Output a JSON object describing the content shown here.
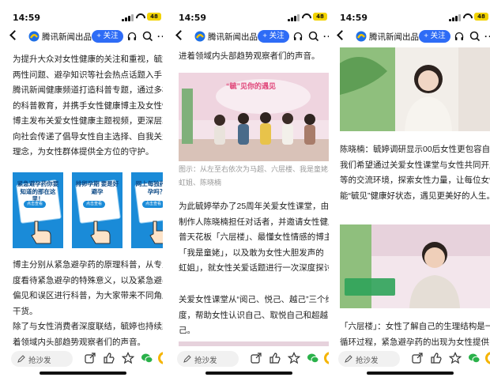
{
  "status": {
    "time": "14:59",
    "battery": "48"
  },
  "header": {
    "source": "腾讯新闻出品",
    "follow_label": "+ 关注"
  },
  "bottom": {
    "comment_placeholder": "抢沙发"
  },
  "colors": {
    "accent": "#2e6cf6",
    "card_blue": "#1a8bd8",
    "stage_pink": "#e0477a"
  },
  "icons": [
    "back-icon",
    "tencent-logo-icon",
    "headphones-icon",
    "search-icon",
    "more-icon",
    "pen-icon",
    "share-icon",
    "like-icon",
    "star-icon",
    "wechat-icon",
    "moments-icon"
  ],
  "screen1": {
    "para1": "为提升大众对女性健康的关注和重视，毓婷从两性问题、避孕知识等社会热点话题入手，在腾讯新闻健康频道打造科普专题，通过多样化的科普教育，并携手女性健康博主及女性情感博主发布关爱女性健康主题视频，更深层次地向社会传递了倡导女性自主选择、自我关爱的理念，为女性群体提供全方位的守护。",
    "cards": [
      {
        "title": "紧急避孕药你要知道的那在这里！",
        "button": "点击查看"
      },
      {
        "title": "排卵孕期 要是好避孕",
        "button": "点击查看"
      },
      {
        "title": "网上每独药能避孕吗？",
        "button": "点击查看"
      }
    ],
    "para2": "博主分别从紧急避孕药的原理科普，从专业角度看待紧急避孕的特殊意义，以及紧急避孕的偏见和误区进行科普，为大家带来不同角度的干货。",
    "para3": "除了与女性消费者深度联结，毓婷也持续跟进着领域内头部趋势观察者们的声音。"
  },
  "screen2": {
    "para_top": "进着领域内头部趋势观察者们的声音。",
    "stage_title": "“毓”见你的遇见",
    "caption": "图示：从左至右依次为马超、六层楼、我是童姥、彩虹姐、陈晓楠",
    "para1": "为此毓婷举办了25周年关爱女性课堂，由著名制作人陈晓楠担任对话者，并邀请女性健康科普天花板「六层楼」、最懂女性情感的博主「我是童姥」，以及敢为女性大胆发声的「彩虹姐」，就女性关爱话题进行一次深度探讨。",
    "para2": "关爱女性课堂从“阅己、悦己、越己”三个维度，帮助女性认识自己、取悦自己和超越自己。"
  },
  "screen3": {
    "para1": "陈晓楠：毓婷调研显示00后女性更包容自主，我们希望通过关爱女性课堂与女性共同开启平等的交流环境，探索女性力量，让每位女性都能“毓见”健康好状态，遇见更美好的人生。",
    "para2": "「六层楼」：女性了解自己的生理结构是一个循环过程，紧急避孕药的出现为女性提供了"
  }
}
